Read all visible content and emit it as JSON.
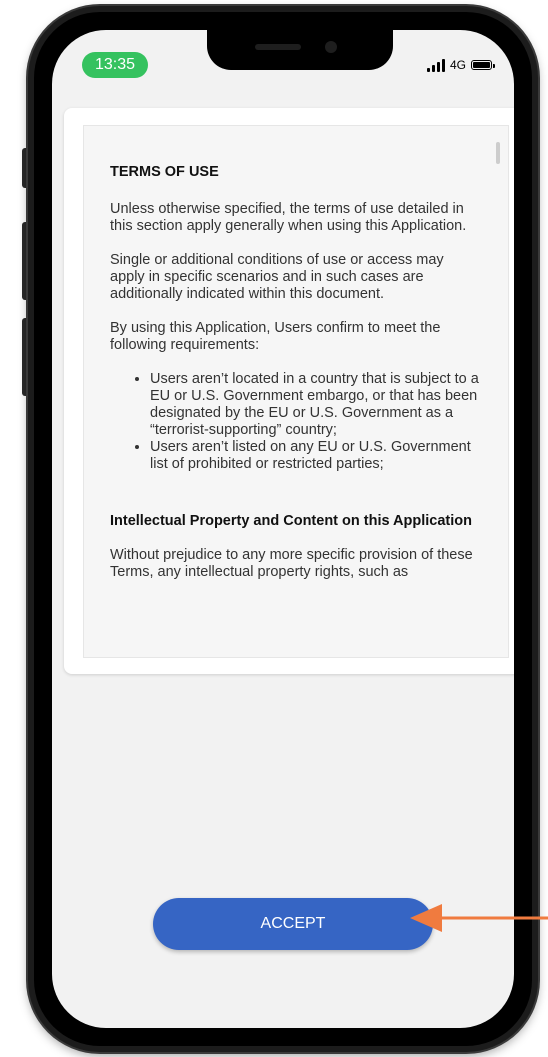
{
  "status_bar": {
    "time": "13:35",
    "network": "4G",
    "icons": [
      "signal-icon",
      "battery-icon"
    ]
  },
  "terms": {
    "title": "TERMS OF USE",
    "paragraphs": [
      "Unless otherwise specified, the terms of use detailed in this section apply generally when using this Application.",
      "Single or additional conditions of use or access may apply in specific scenarios and in such cases are additionally indicated within this document.",
      "By using this Application, Users confirm to meet the following requirements:"
    ],
    "requirements": [
      "Users aren’t located in a country that is subject to a EU or U.S. Government embargo, or that has been designated by the EU or U.S. Government as a “terrorist-supporting” country;",
      "Users aren’t listed on any EU or U.S. Government list of prohibited or restricted parties;"
    ],
    "section_heading": "Intellectual Property and Content on this Application",
    "section_paragraph": "Without prejudice to any more specific provision of these Terms, any intellectual property rights, such as"
  },
  "accept_button": {
    "label": "ACCEPT"
  },
  "colors": {
    "accent": "#3665c4",
    "time_pill": "#35c25f",
    "annotation_arrow": "#f07b3f"
  }
}
